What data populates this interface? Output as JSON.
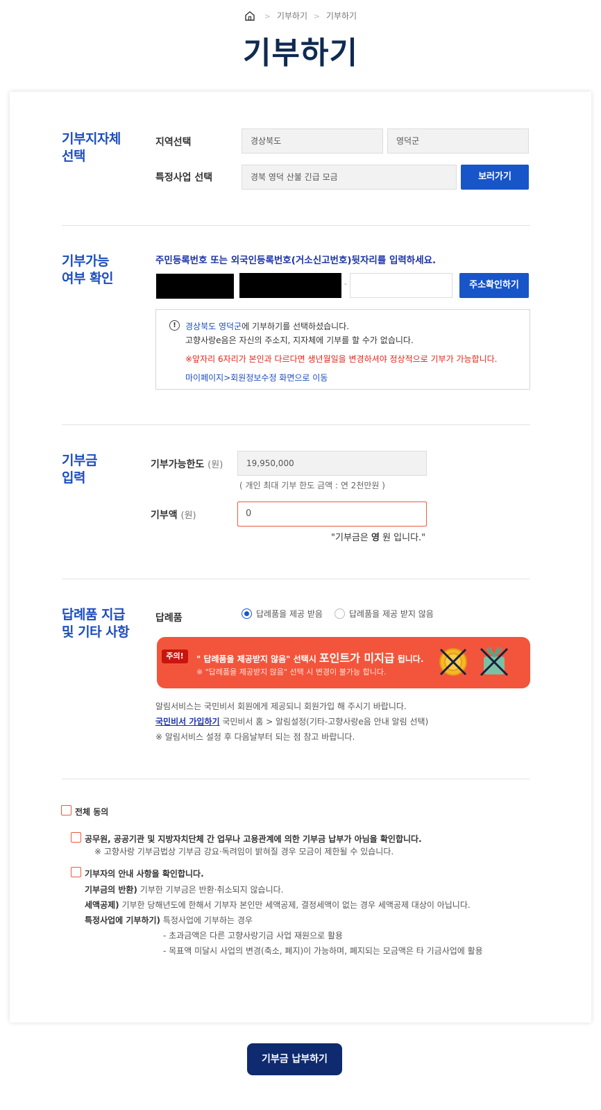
{
  "breadcrumb": [
    "기부하기",
    "기부하기"
  ],
  "page_title": "기부하기",
  "section1": {
    "title": "기부지자체\n선택",
    "region_label": "지역선택",
    "province": "경상북도",
    "district": "영덕군",
    "project_label": "특정사업 선택",
    "project": "경북 영덕 산불 긴급 모금",
    "view_button": "보러가기"
  },
  "section2": {
    "title": "기부가능\n여부 확인",
    "instruction": "주민등록번호 또는 외국인등록번호(거소신고번호)뒷자리를 입력하세요.",
    "dash": "-",
    "address_button": "주소확인하기",
    "notice": {
      "region_text": "경상북도 영덕군",
      "line1_suffix": "에 기부하기를 선택하셨습니다.",
      "line2": "고향사랑e음은 자신의 주소지, 지자체에 기부를 할 수가 없습니다.",
      "line3": "※앞자리 6자리가 본인과 다르다면 생년월일을 변경하셔야 정상적으로 기부가 가능합니다.",
      "line4": "마이페이지>회원정보수정 화면으로 이동"
    }
  },
  "section3": {
    "title": "기부금\n입력",
    "limit_label": "기부가능한도",
    "limit_unit": "(원)",
    "limit_value": "19,950,000",
    "limit_note": "( 개인 최대 기부 한도 금액 : 연 2천만원 )",
    "amount_label": "기부액",
    "amount_unit": "(원)",
    "amount_value": "0",
    "amount_text_prefix": "\"기부금은 ",
    "amount_text_bold": "영",
    "amount_text_suffix": " 원 입니다.\""
  },
  "section4": {
    "title": "답례품 지급\n및 기타 사항",
    "gift_label": "답례품",
    "radio_receive": "답례품을 제공 받음",
    "radio_not_receive": "답례품을 제공 받지 않음",
    "banner": {
      "tag": "주의!",
      "msg_prefix": "\" 답례품을 제공받지 않음\" 선택시 ",
      "msg_big": "포인트가 미지급",
      "msg_suffix": " 됩니다.",
      "sub": "※ \"답례품을 제공받지 않음\" 선택 시 변경이 불가능 합니다."
    },
    "info1": "알림서비스는 국민비서 회원에게 제공되니 회원가입 해 주시기 바랍니다.",
    "info2_link": "국민비서 가입하기",
    "info2_rest": " 국민비서 홈 > 알림설정(기타-고향사랑e음 안내 알림 선택)",
    "info3": "※ 알림서비스 설정 후 다음날부터 되는 점 참고 바랍니다."
  },
  "agreements": {
    "all": "전체 동의",
    "item1": "공무원, 공공기관 및 지방자치단체 간 업무나 고용관계에 의한 기부금 납부가 아님을 확인합니다.",
    "item1_sub": "※ 고향사랑 기부금법상 기부금 강요·독려임이 밝혀질 경우 모금이 제한될 수 있습니다.",
    "item2": "기부자의 안내 사항을 확인합니다.",
    "refund_label": "기부금의 반환)",
    "refund_text": " 기부한 기부금은 반환·취소되지 않습니다.",
    "tax_label": "세액공제)",
    "tax_text": " 기부한 당해년도에 한해서 기부자 본인만 세액공제, 결정세액이 없는 경우 세액공제 대상이 아닙니다.",
    "project_label": "특정사업에 기부하기)",
    "project_text": " 특정사업에 기부하는 경우",
    "bullet1": "- 초과금액은 다른 고향사랑기금 사업 재원으로 활용",
    "bullet2": "- 목표액 미달시 사업의 변경(축소, 폐지)이 가능하며, 폐지되는 모금액은 타 기금사업에 활용"
  },
  "submit_button": "기부금 납부하기",
  "colors": {
    "primary_blue": "#1755c8",
    "title_navy": "#0f2a52",
    "alert_red": "#e0261b",
    "banner_orange": "#f2553b"
  }
}
